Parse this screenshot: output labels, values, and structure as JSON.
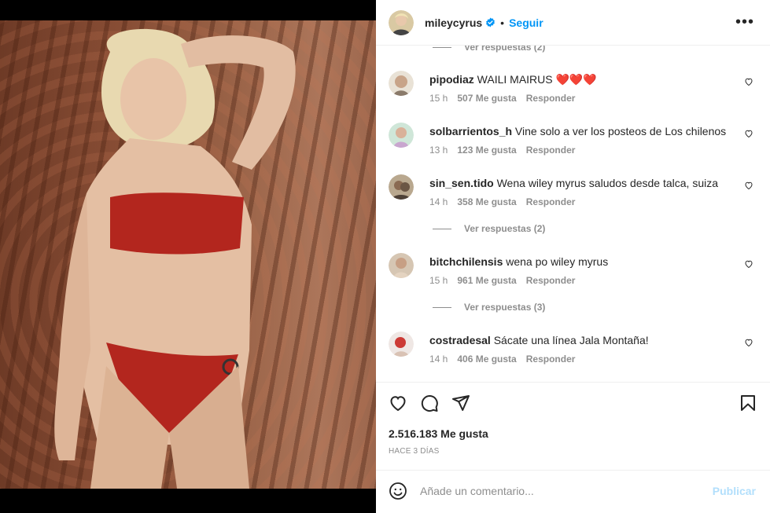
{
  "post": {
    "author": "mileycyrus",
    "follow_label": "Seguir",
    "separator": "•",
    "more_label": "•••"
  },
  "comments": {
    "top_view_replies": "Ver respuestas (2)",
    "items": [
      {
        "username": "pipodiaz",
        "text": "WAILI MAIRUS",
        "hearts": "❤️❤️❤️",
        "time": "15 h",
        "likes": "507 Me gusta",
        "reply": "Responder"
      },
      {
        "username": "solbarrientos_h",
        "text": "Vine solo a ver los posteos de Los chilenos cu",
        "time": "13 h",
        "likes": "123 Me gusta",
        "reply": "Responder"
      },
      {
        "username": "sin_sen.tido",
        "text": "Wena wiley myrus saludos desde talca, suiza",
        "time": "14 h",
        "likes": "358 Me gusta",
        "reply": "Responder",
        "view_replies": "Ver respuestas (2)"
      },
      {
        "username": "bitchchilensis",
        "text": "wena po wiley myrus",
        "time": "15 h",
        "likes": "961 Me gusta",
        "reply": "Responder",
        "view_replies": "Ver respuestas (3)"
      },
      {
        "username": "costradesal",
        "text": "Sácate una línea Jala Montaña!",
        "time": "14 h",
        "likes": "406 Me gusta",
        "reply": "Responder"
      }
    ]
  },
  "stats": {
    "likes": "2.516.183 Me gusta",
    "timestamp": "HACE 3 DÍAS"
  },
  "comment_box": {
    "placeholder": "Añade un comentario...",
    "publish_label": "Publicar"
  },
  "colors": {
    "accent": "#0095f6",
    "publish_disabled": "#b2dffc",
    "verified": "#0095f6",
    "heart_red": "#ed4956",
    "muted": "#8e8e8e"
  },
  "icons": [
    "verified-badge-icon",
    "more-options-icon",
    "heart-outline-icon",
    "comment-bubble-icon",
    "share-plane-icon",
    "bookmark-icon",
    "emoji-smile-icon"
  ]
}
